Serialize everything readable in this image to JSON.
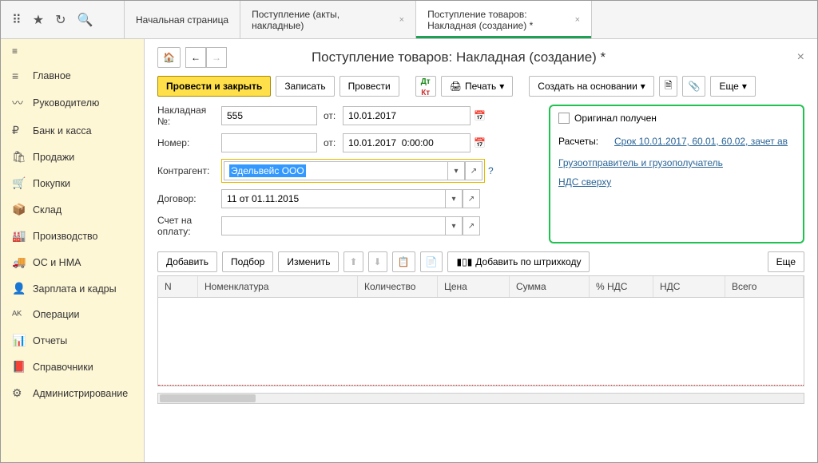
{
  "topbar": {
    "tabs": [
      {
        "label": "Начальная страница"
      },
      {
        "label": "Поступление (акты, накладные)"
      },
      {
        "label": "Поступление товаров: Накладная (создание) *"
      }
    ]
  },
  "sidebar": {
    "items": [
      {
        "icon": "≡",
        "label": "Главное"
      },
      {
        "icon": "〰",
        "label": "Руководителю"
      },
      {
        "icon": "₽",
        "label": "Банк и касса"
      },
      {
        "icon": "🛍",
        "label": "Продажи"
      },
      {
        "icon": "🛒",
        "label": "Покупки"
      },
      {
        "icon": "📦",
        "label": "Склад"
      },
      {
        "icon": "🏭",
        "label": "Производство"
      },
      {
        "icon": "🚚",
        "label": "ОС и НМА"
      },
      {
        "icon": "👤",
        "label": "Зарплата и кадры"
      },
      {
        "icon": "ᴬᴷ",
        "label": "Операции"
      },
      {
        "icon": "📊",
        "label": "Отчеты"
      },
      {
        "icon": "📕",
        "label": "Справочники"
      },
      {
        "icon": "⚙",
        "label": "Администрирование"
      }
    ]
  },
  "page": {
    "title": "Поступление товаров: Накладная (создание) *"
  },
  "toolbar": {
    "post_close": "Провести и закрыть",
    "save": "Записать",
    "post": "Провести",
    "print": "Печать",
    "create_based": "Создать на основании",
    "more": "Еще"
  },
  "form": {
    "invoice_no_label": "Накладная №:",
    "invoice_no": "555",
    "from_label": "от:",
    "invoice_date": "10.01.2017",
    "number_label": "Номер:",
    "number": "",
    "number_date": "10.01.2017  0:00:00",
    "counterparty_label": "Контрагент:",
    "counterparty": "Эдельвейс ООО",
    "contract_label": "Договор:",
    "contract": "11 от 01.11.2015",
    "invoice_pay_label": "Счет на оплату:",
    "invoice_pay": ""
  },
  "right": {
    "original_received": "Оригинал получен",
    "calc_label": "Расчеты:",
    "calc_link": "Срок 10.01.2017, 60.01, 60.02, зачет ав",
    "shipper_link": "Грузоотправитель и грузополучатель",
    "vat_link": "НДС сверху"
  },
  "grid_toolbar": {
    "add": "Добавить",
    "pick": "Подбор",
    "edit": "Изменить",
    "barcode": "Добавить по штрихкоду",
    "more": "Еще"
  },
  "grid": {
    "columns": [
      "N",
      "Номенклатура",
      "Количество",
      "Цена",
      "Сумма",
      "% НДС",
      "НДС",
      "Всего"
    ]
  }
}
